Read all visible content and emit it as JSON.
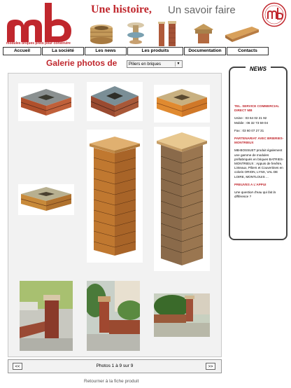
{
  "header": {
    "logo_caption": "modules briques prêts pour construire",
    "tagline_main": "Une histoire,",
    "tagline_sub": "Un savoir faire"
  },
  "nav": [
    {
      "label": "Accueil"
    },
    {
      "label": "La société"
    },
    {
      "label": "Les news"
    },
    {
      "label": "Les produits"
    },
    {
      "label": "Documentation"
    },
    {
      "label": "Contacts"
    }
  ],
  "gallery": {
    "title": "Galerie photos de",
    "select_value": "Piliers en briques",
    "pager_info": "Photos 1 à 9 sur 9",
    "prev_label": "<<",
    "next_label": ">>",
    "back_link": "Retourner à la fiche produit"
  },
  "news": {
    "title": "NEWS",
    "service_title": "TEL. SERVICE COMMERCIAL DIRECT MB",
    "usine": "Usine : 03 64 02 21 92",
    "mobile": "Mobile : 06 32 73 59 04",
    "fax": "Fax : 03 60 07 27 31",
    "partenariat_title": "PARTENARIAT AVEC BRIERIES-MONTRIEUX",
    "partenariat_text": "MB-BOSSUET produit également une gamme de modules préfabriqués en briques BATRIES-MONTRIEUX : Appuis de fenêtre, Linteaux, Piliers et Couvertines en coloris ORION, LYNX, VAL DE LOIRE, MONTLOUIS ...",
    "apropos_title": "PREUVES A L'APPUI",
    "apropos_text": "Une question d'eau qui fait la différence ?"
  }
}
